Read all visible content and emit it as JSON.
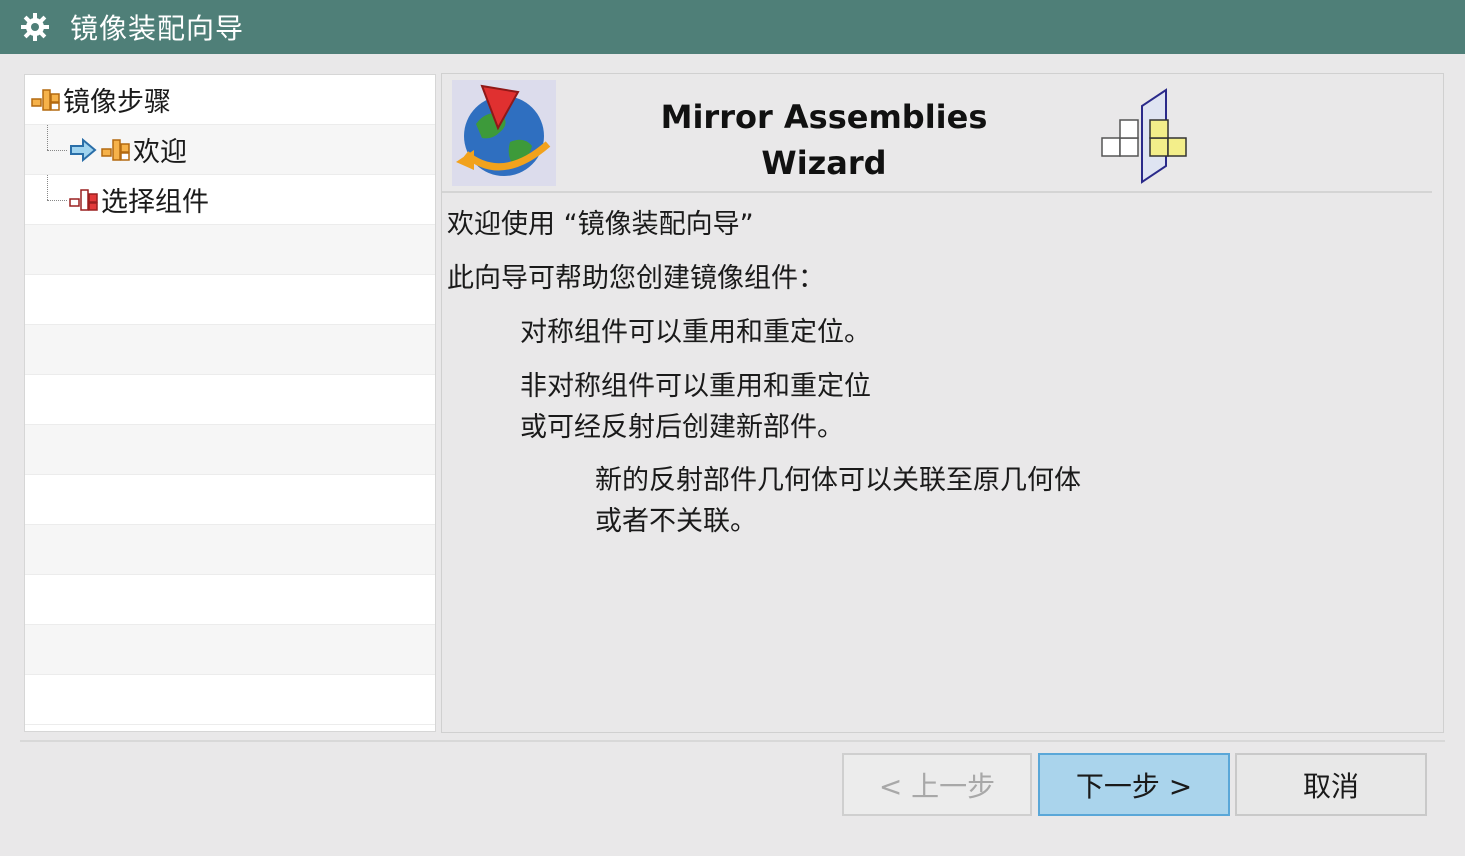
{
  "window": {
    "title": "镜像装配向导",
    "title_icon": "gear-icon",
    "title_bar_color": "#4f7f78"
  },
  "tree": {
    "root_label": "镜像步骤",
    "items": [
      {
        "label": "欢迎",
        "current": true
      },
      {
        "label": "选择组件",
        "current": false
      }
    ]
  },
  "banner": {
    "title_line1": "Mirror Assemblies",
    "title_line2": "Wizard",
    "left_icon": "globe-icon",
    "right_icon": "mirror-assembly-icon"
  },
  "content": {
    "welcome": "欢迎使用 “镜像装配向导”",
    "intro": "此向导可帮助您创建镜像组件：",
    "item1": "对称组件可以重用和重定位。",
    "item2_line1": "非对称组件可以重用和重定位",
    "item2_line2": "或可经反射后创建新部件。",
    "sub_line1": "新的反射部件几何体可以关联至原几何体",
    "sub_line2": "或者不关联。"
  },
  "buttons": {
    "back": "< 上一步",
    "next": "下一步 >",
    "cancel": "取消"
  },
  "colors": {
    "primary_button": "#aad4ec",
    "primary_border": "#5aa7d8"
  }
}
